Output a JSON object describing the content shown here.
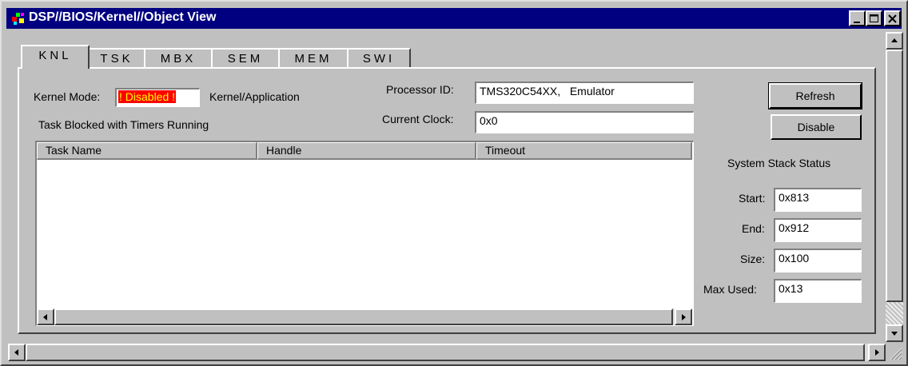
{
  "window": {
    "title": "DSP//BIOS/Kernel//Object View"
  },
  "tabs": [
    {
      "label": "KNL",
      "active": true
    },
    {
      "label": "TSK",
      "active": false
    },
    {
      "label": "MBX",
      "active": false
    },
    {
      "label": "SEM",
      "active": false
    },
    {
      "label": "MEM",
      "active": false
    },
    {
      "label": "SWI",
      "active": false
    }
  ],
  "kernel": {
    "mode_label": "Kernel Mode:",
    "mode_value": "! Disabled !",
    "scope_label": "Kernel/Application",
    "blocked_label": "Task Blocked with Timers Running"
  },
  "processor": {
    "id_label": "Processor ID:",
    "id_value": "TMS320C54XX,   Emulator",
    "clock_label": "Current Clock:",
    "clock_value": "0x0"
  },
  "buttons": {
    "refresh": "Refresh",
    "disable": "Disable"
  },
  "task_table": {
    "columns": [
      "Task Name",
      "Handle",
      "Timeout"
    ],
    "rows": []
  },
  "stack": {
    "title": "System Stack Status",
    "start_label": "Start:",
    "start_value": "0x813",
    "end_label": "End:",
    "end_value": "0x912",
    "size_label": "Size:",
    "size_value": "0x100",
    "max_label": "Max Used:",
    "max_value": "0x13"
  },
  "colors": {
    "titlebar": "#000080",
    "face": "#c0c0c0",
    "badge_bg": "#ff0000",
    "badge_fg": "#ffff00"
  },
  "icons": {
    "app": "dsp-bios-app-icon",
    "minimize": "minimize-icon",
    "maximize": "maximize-icon",
    "close": "close-icon"
  }
}
